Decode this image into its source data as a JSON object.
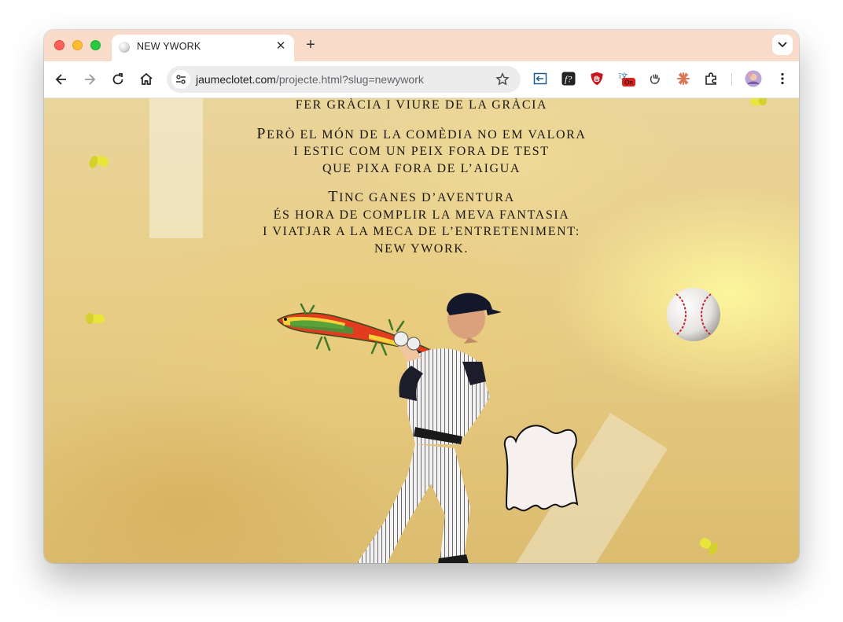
{
  "browser": {
    "tab": {
      "title": "NEW YWORK",
      "favicon": "baseball-icon"
    },
    "address_bar": {
      "domain": "jaumeclotet.com",
      "path": "/projecte.html?slug=newywork"
    },
    "extensions": [
      "reader-icon",
      "fontface-icon",
      "ublock-icon",
      "translate-icon",
      "gesture-icon",
      "claude-icon",
      "puzzle-icon"
    ],
    "extension_badge": "On"
  },
  "page": {
    "poem": [
      [
        "FER GRÀCIA I VIURE DE LA GRÀCIA"
      ],
      [
        "PERÒ EL MÓN DE LA COMÈDIA NO EM VALORA",
        "I ESTIC COM UN PEIX FORA DE TEST",
        "QUE PIXA FORA DE L’AIGUA"
      ],
      [
        "TINC GANES D’AVENTURA",
        "ÉS HORA DE COMPLIR LA MEVA FANTASIA",
        "I VIATJAR A LA MECA DE L’ENTRETENIMENT:",
        "NEW YWORK."
      ]
    ],
    "colors": {
      "tab_strip": "#f9dbc9",
      "pin_yellow": "#e8e63a",
      "text": "#1a1712"
    }
  }
}
